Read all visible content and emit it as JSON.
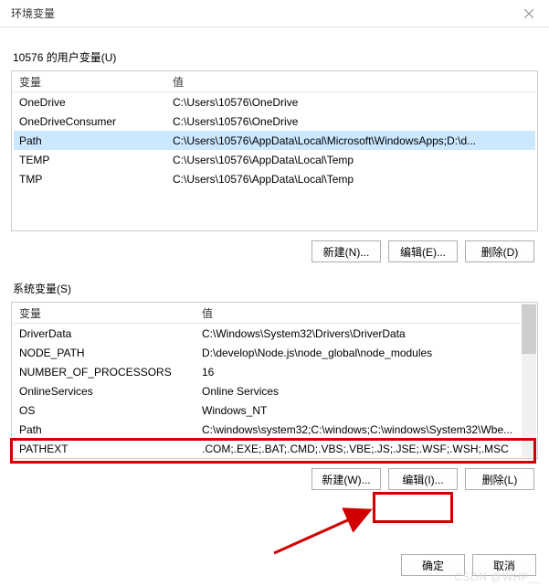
{
  "window": {
    "title": "环境变量"
  },
  "user_section": {
    "label": "10576 的用户变量(U)",
    "header_name": "变量",
    "header_value": "值",
    "rows": [
      {
        "name": "OneDrive",
        "value": "C:\\Users\\10576\\OneDrive"
      },
      {
        "name": "OneDriveConsumer",
        "value": "C:\\Users\\10576\\OneDrive"
      },
      {
        "name": "Path",
        "value": "C:\\Users\\10576\\AppData\\Local\\Microsoft\\WindowsApps;D:\\d..."
      },
      {
        "name": "TEMP",
        "value": "C:\\Users\\10576\\AppData\\Local\\Temp"
      },
      {
        "name": "TMP",
        "value": "C:\\Users\\10576\\AppData\\Local\\Temp"
      }
    ],
    "selected_index": 2,
    "buttons": {
      "new": "新建(N)...",
      "edit": "编辑(E)...",
      "delete": "删除(D)"
    }
  },
  "system_section": {
    "label": "系统变量(S)",
    "header_name": "变量",
    "header_value": "值",
    "rows": [
      {
        "name": "DriverData",
        "value": "C:\\Windows\\System32\\Drivers\\DriverData"
      },
      {
        "name": "NODE_PATH",
        "value": "D:\\develop\\Node.js\\node_global\\node_modules"
      },
      {
        "name": "NUMBER_OF_PROCESSORS",
        "value": "16"
      },
      {
        "name": "OnlineServices",
        "value": "Online Services"
      },
      {
        "name": "OS",
        "value": "Windows_NT"
      },
      {
        "name": "Path",
        "value": "C:\\windows\\system32;C:\\windows;C:\\windows\\System32\\Wbe..."
      },
      {
        "name": "PATHEXT",
        "value": ".COM;.EXE;.BAT;.CMD;.VBS;.VBE;.JS;.JSE;.WSF;.WSH;.MSC"
      }
    ],
    "buttons": {
      "new": "新建(W)...",
      "edit": "编辑(I)...",
      "delete": "删除(L)"
    }
  },
  "dialog_buttons": {
    "ok": "确定",
    "cancel": "取消"
  },
  "watermark": "CSDN @WHF__"
}
